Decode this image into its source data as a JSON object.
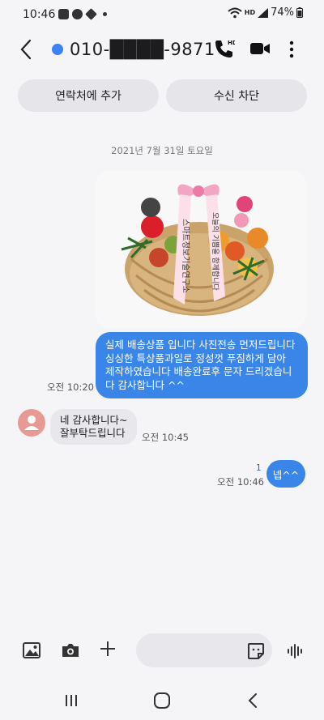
{
  "status_bar": {
    "time": "10:46",
    "network_label": "HD",
    "battery_percent": "74%"
  },
  "header": {
    "contact_name": "010-████-9871"
  },
  "actions": {
    "add_contact": "연락처에 추가",
    "block": "수신 차단"
  },
  "conversation": {
    "date_divider": "2021년 7월 31일 토요일",
    "photo_ribbon_left": "스마트정보기술연구소",
    "photo_ribbon_right": "오늘의 기쁨을 함께합니다",
    "messages": [
      {
        "direction": "outgoing",
        "text": "실제 배송상품 입니다 사진전송 먼저드립니다 싱싱한 특상품과일로 정성껏 푸짐하게 담아 제작하였습니다 배송완료후 문자 드리겠습니다 감사합니다 ^^",
        "time": "오전 10:20"
      },
      {
        "direction": "incoming",
        "text": "네 감사합니다~\n잘부탁드립니다",
        "time": "오전 10:45"
      },
      {
        "direction": "outgoing",
        "text": "넵^^",
        "time": "오전 10:46",
        "unread_count": "1"
      }
    ]
  },
  "composer": {
    "placeholder": ""
  },
  "colors": {
    "outgoing_bubble": "#3a86e8",
    "incoming_bubble": "#e8e8ec",
    "accent": "#3b82f6",
    "avatar": "#e79a93"
  }
}
